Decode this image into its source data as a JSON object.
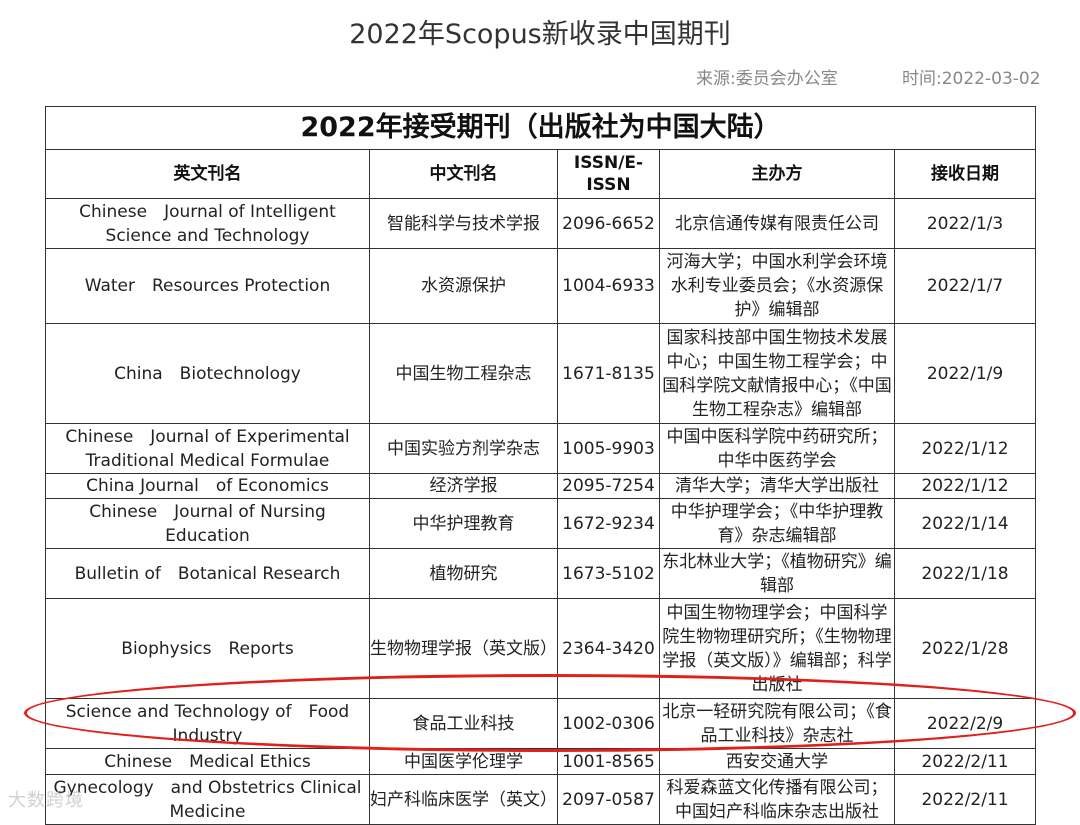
{
  "article": {
    "title": "2022年Scopus新收录中国期刊",
    "source": "来源:委员会办公室",
    "time": "时间:2022-03-02"
  },
  "table": {
    "title": "2022年接受期刊（出版社为中国大陆）",
    "headers": [
      "英文刊名",
      "中文刊名",
      "ISSN/E-ISSN",
      "主办方",
      "接收日期"
    ],
    "rows": [
      {
        "en": "Chinese　Journal of Intelligent Science and Technology",
        "cn": "智能科学与技术学报",
        "issn": "2096-6652",
        "org": "北京信通传媒有限责任公司",
        "date": "2022/1/3"
      },
      {
        "en": "Water　Resources Protection",
        "cn": "水资源保护",
        "issn": "1004-6933",
        "org": "河海大学；中国水利学会环境水利专业委员会；《水资源保护》编辑部",
        "date": "2022/1/7"
      },
      {
        "en": "China　Biotechnology",
        "cn": "中国生物工程杂志",
        "issn": "1671-8135",
        "org": "国家科技部中国生物技术发展中心；中国生物工程学会；中国科学院文献情报中心；《中国生物工程杂志》编辑部",
        "date": "2022/1/9"
      },
      {
        "en": "Chinese　Journal of Experimental Traditional Medical Formulae",
        "cn": "中国实验方剂学杂志",
        "issn": "1005-9903",
        "org": "中国中医科学院中药研究所；中华中医药学会",
        "date": "2022/1/12"
      },
      {
        "en": "China Journal　of Economics",
        "cn": "经济学报",
        "issn": "2095-7254",
        "org": "清华大学；清华大学出版社",
        "date": "2022/1/12"
      },
      {
        "en": "Chinese　Journal of Nursing Education",
        "cn": "中华护理教育",
        "issn": "1672-9234",
        "org": "中华护理学会；《中华护理教育》杂志编辑部",
        "date": "2022/1/14"
      },
      {
        "en": "Bulletin of　Botanical Research",
        "cn": "植物研究",
        "issn": "1673-5102",
        "org": "东北林业大学；《植物研究》编辑部",
        "date": "2022/1/18"
      },
      {
        "en": "Biophysics　Reports",
        "cn": "生物物理学报（英文版）",
        "issn": "2364-3420",
        "org": "中国生物物理学会；中国科学院生物物理研究所；《生物物理学报（英文版）》编辑部；科学出版社",
        "date": "2022/1/28"
      },
      {
        "en": "Science and Technology of　Food Industry",
        "cn": "食品工业科技",
        "issn": "1002-0306",
        "org": "北京一轻研究院有限公司；《食品工业科技》杂志社",
        "date": "2022/2/9"
      },
      {
        "en": "Chinese　Medical Ethics",
        "cn": "中国医学伦理学",
        "issn": "1001-8565",
        "org": "西安交通大学",
        "date": "2022/2/11"
      },
      {
        "en": "Gynecology　and Obstetrics Clinical Medicine",
        "cn": "妇产科临床医学（英文）",
        "issn": "2097-0587",
        "org": "科爱森蓝文化传播有限公司；中国妇产科临床杂志出版社",
        "date": "2022/2/11"
      }
    ]
  },
  "watermark": "大数跨境",
  "colors": {
    "highlight_circle": "#e0201a"
  }
}
